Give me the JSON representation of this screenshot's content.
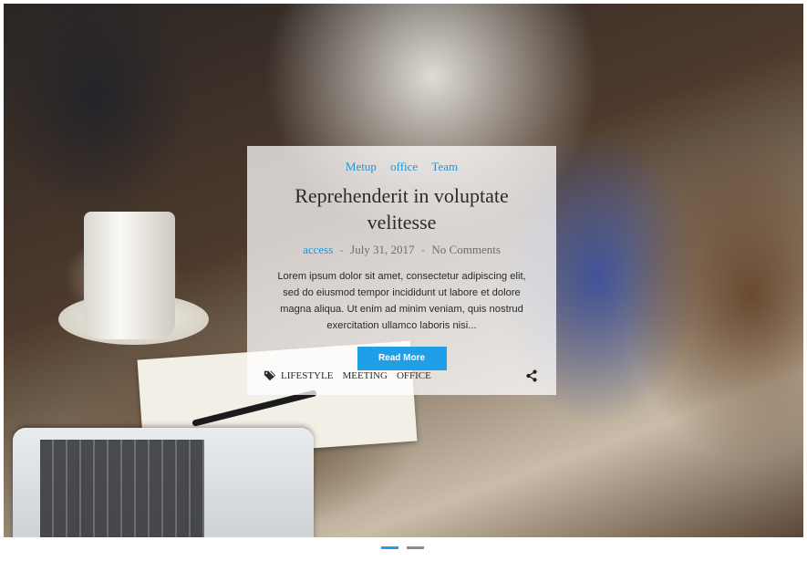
{
  "post": {
    "categories": [
      "Metup",
      "office",
      "Team"
    ],
    "title": "Reprehenderit in voluptate velitesse",
    "author": "access",
    "date": "July 31, 2017",
    "comments": "No Comments",
    "excerpt": "Lorem ipsum dolor sit amet, consectetur adipiscing elit, sed do eiusmod tempor incididunt ut labore et dolore magna aliqua. Ut enim ad minim veniam, quis nostrud exercitation ullamco laboris nisi...",
    "read_more": "Read More",
    "tags": [
      "LIFESTYLE",
      "MEETING",
      "OFFICE"
    ]
  },
  "separator": "-",
  "colors": {
    "accent": "#1e9fe8",
    "link": "#1a96dd",
    "title": "#2b2b2b"
  },
  "icons": {
    "tag": "tags-icon",
    "share": "share-icon"
  },
  "slider": {
    "active_slide": 1,
    "slide_count": 2
  }
}
